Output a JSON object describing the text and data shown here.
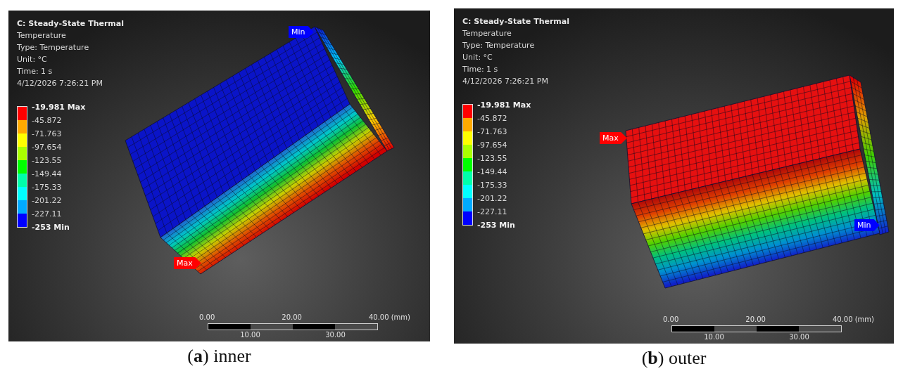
{
  "panels": [
    {
      "header": {
        "title": "C: Steady-State Thermal",
        "lines": [
          "Temperature",
          "Type: Temperature",
          "Unit: °C",
          "Time: 1 s",
          "4/12/2026 7:26:21 PM"
        ]
      },
      "legend": {
        "labels": [
          {
            "text": "-19.981 Max",
            "kind": "max"
          },
          {
            "text": "-45.872",
            "kind": "value"
          },
          {
            "text": "-71.763",
            "kind": "value"
          },
          {
            "text": "-97.654",
            "kind": "value"
          },
          {
            "text": "-123.55",
            "kind": "value"
          },
          {
            "text": "-149.44",
            "kind": "value"
          },
          {
            "text": "-175.33",
            "kind": "value"
          },
          {
            "text": "-201.22",
            "kind": "value"
          },
          {
            "text": "-227.11",
            "kind": "value"
          },
          {
            "text": "-253 Min",
            "kind": "min"
          }
        ],
        "bands": [
          {
            "color": "#ff0000"
          },
          {
            "color": "#ffaa00"
          },
          {
            "color": "#ffff00"
          },
          {
            "color": "#aaff00"
          },
          {
            "color": "#00ff00"
          },
          {
            "color": "#00ffaa"
          },
          {
            "color": "#00ffff"
          },
          {
            "color": "#00aaff"
          },
          {
            "color": "#0000ff"
          }
        ]
      },
      "probes": [
        {
          "text": "Min",
          "color": "#0000ff"
        },
        {
          "text": "Max",
          "color": "#ff0000"
        }
      ],
      "scale": {
        "top_labels": [
          "0.00",
          "20.00",
          "40.00 (mm)"
        ],
        "bottom_labels": [
          "10.00",
          "30.00"
        ]
      },
      "caption": "(**a**) inner"
    },
    {
      "header": {
        "title": "C: Steady-State Thermal",
        "lines": [
          "Temperature",
          "Type: Temperature",
          "Unit: °C",
          "Time: 1 s",
          "4/12/2026 7:26:21 PM"
        ]
      },
      "legend": {
        "labels": [
          {
            "text": "-19.981 Max",
            "kind": "max"
          },
          {
            "text": "-45.872",
            "kind": "value"
          },
          {
            "text": "-71.763",
            "kind": "value"
          },
          {
            "text": "-97.654",
            "kind": "value"
          },
          {
            "text": "-123.55",
            "kind": "value"
          },
          {
            "text": "-149.44",
            "kind": "value"
          },
          {
            "text": "-175.33",
            "kind": "value"
          },
          {
            "text": "-201.22",
            "kind": "value"
          },
          {
            "text": "-227.11",
            "kind": "value"
          },
          {
            "text": "-253 Min",
            "kind": "min"
          }
        ],
        "bands": [
          {
            "color": "#ff0000"
          },
          {
            "color": "#ffaa00"
          },
          {
            "color": "#ffff00"
          },
          {
            "color": "#aaff00"
          },
          {
            "color": "#00ff00"
          },
          {
            "color": "#00ffaa"
          },
          {
            "color": "#00ffff"
          },
          {
            "color": "#00aaff"
          },
          {
            "color": "#0000ff"
          }
        ]
      },
      "probes": [
        {
          "text": "Max",
          "color": "#ff0000"
        },
        {
          "text": "Min",
          "color": "#0000ff"
        }
      ],
      "scale": {
        "top_labels": [
          "0.00",
          "20.00",
          "40.00 (mm)"
        ],
        "bottom_labels": [
          "10.00",
          "30.00"
        ]
      },
      "caption": "(**b**) outer"
    }
  ]
}
